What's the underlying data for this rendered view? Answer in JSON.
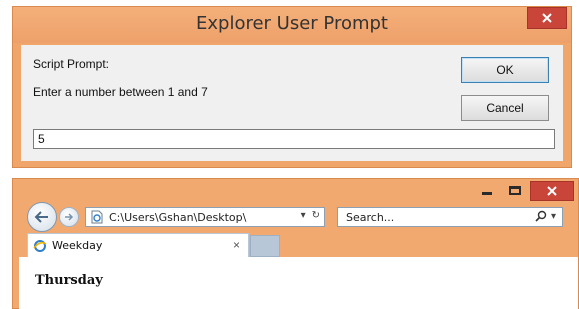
{
  "dialog": {
    "title": "Explorer User Prompt",
    "prompt_label": "Script Prompt:",
    "message": "Enter a number between 1 and 7",
    "input_value": "5",
    "ok_label": "OK",
    "cancel_label": "Cancel",
    "close_icon": "close-icon"
  },
  "browser": {
    "address": "C:\\Users\\Gshan\\Desktop\\",
    "search_placeholder": "Search...",
    "tab_label": "Weekday",
    "tab_close": "×",
    "content_text": "Thursday",
    "icons": [
      "back-arrow-icon",
      "forward-arrow-icon",
      "page-icon",
      "dropdown-arrow-icon",
      "refresh-icon",
      "search-icon",
      "ie-logo-icon",
      "minimize-icon",
      "maximize-icon",
      "close-icon"
    ]
  },
  "colors": {
    "frame": "#f0a56a",
    "close_button": "#c9453a",
    "dialog_body": "#f0f0f0"
  }
}
